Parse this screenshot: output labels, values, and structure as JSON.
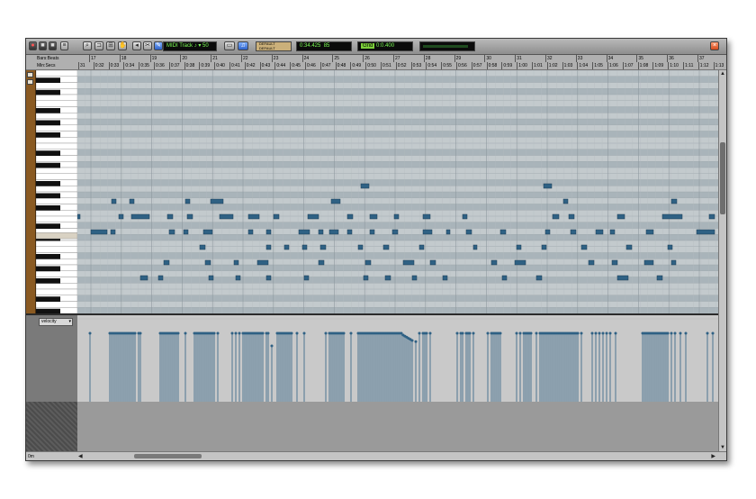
{
  "toolbar": {
    "track_name": "MIDI Track",
    "velocity_value": "50",
    "status_lines": [
      "DEFAULT",
      "DEFAULT"
    ],
    "counter": "0:34.425",
    "counter_value": "85",
    "grid_label": "Grid",
    "grid_value": "0:0.400"
  },
  "rulers": {
    "bars_label": "Bars:Beats",
    "time_label": "Min:Secs",
    "bars": [
      "17",
      "18",
      "19",
      "20",
      "21",
      "22",
      "23",
      "24",
      "25",
      "26",
      "27",
      "28",
      "29",
      "30",
      "31",
      "32",
      "33",
      "34",
      "35",
      "36",
      "37"
    ],
    "times": [
      "31",
      "0:32",
      "0:33",
      "0:34",
      "0:35",
      "0:36",
      "0:37",
      "0:38",
      "0:39",
      "0:40",
      "0:41",
      "0:42",
      "0:43",
      "0:44",
      "0:45",
      "0:46",
      "0:47",
      "0:48",
      "0:49",
      "0:50",
      "0:51",
      "0:52",
      "0:53",
      "0:54",
      "0:55",
      "0:56",
      "0:57",
      "0:58",
      "0:59",
      "1:00",
      "1:01",
      "1:02",
      "1:03",
      "1:04",
      "1:05",
      "1:06",
      "1:07",
      "1:08",
      "1:09",
      "1:10",
      "1:11",
      "1:12",
      "1:13"
    ]
  },
  "velocity_lane": {
    "label": "velocity",
    "dropdown_glyph": "▾"
  },
  "zoom_label": "0m",
  "colors": {
    "note": "#2f6184",
    "grid_bg": "#bfc6ca",
    "lane_row": "#a9b4ba",
    "lcd_green": "#7cff55",
    "brown_strip": "#8a5a22"
  },
  "icons": {
    "close": "close-icon",
    "zoom": "zoom-icon",
    "pencil": "pencil-icon",
    "grabber": "grabber-icon",
    "trim": "trim-icon",
    "note": "note-icon",
    "speaker": "speaker-icon"
  }
}
